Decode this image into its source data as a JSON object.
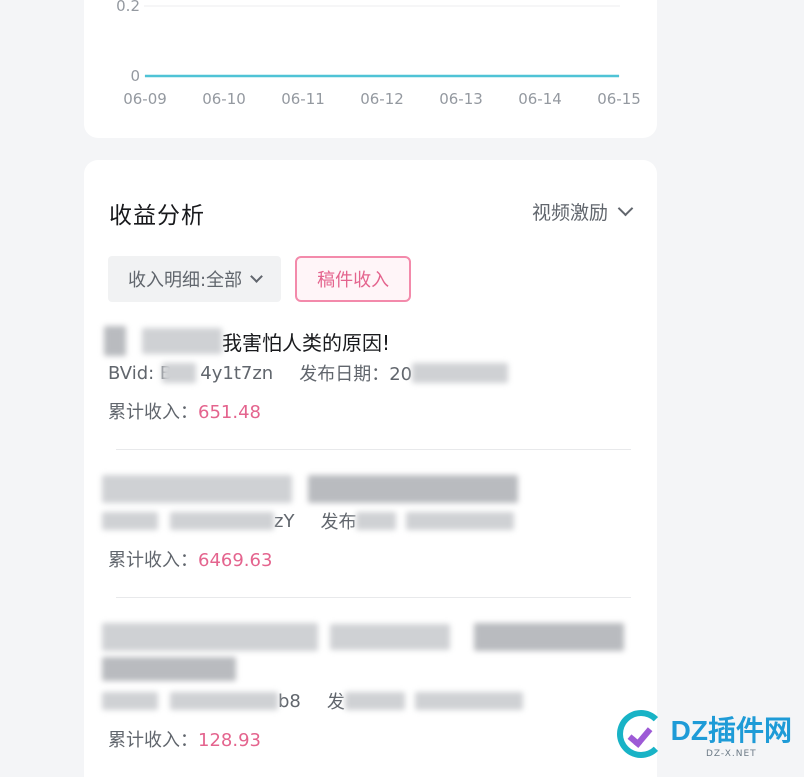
{
  "chart_data": {
    "type": "line",
    "x": [
      "06-09",
      "06-10",
      "06-11",
      "06-12",
      "06-13",
      "06-14",
      "06-15"
    ],
    "y_ticks": [
      "0",
      "0.2"
    ],
    "series": [
      {
        "values": [
          0,
          0,
          0,
          0,
          0,
          0,
          0
        ],
        "color": "#4fc3d6"
      }
    ],
    "grid": true
  },
  "income": {
    "title": "收益分析",
    "selector_label": "视频激励",
    "filter_dropdown": "收入明细:全部",
    "filter_button": "稿件收入",
    "income_label": "累计收入：",
    "items": [
      {
        "title_visible": "我害怕人类的原因!",
        "bvid_visible": "BVid: B",
        "bvid_tail": "4y1t7zn",
        "date_label": "发布日期：20",
        "income_value": "651.48"
      },
      {
        "bvid_tail": "zY",
        "date_label": "发布",
        "income_value": "6469.63"
      },
      {
        "bvid_tail": "b8",
        "date_label": "发",
        "income_value": "128.93"
      }
    ]
  },
  "watermark": {
    "main": "DZ插件网",
    "sub": "DZ-X.NET"
  }
}
